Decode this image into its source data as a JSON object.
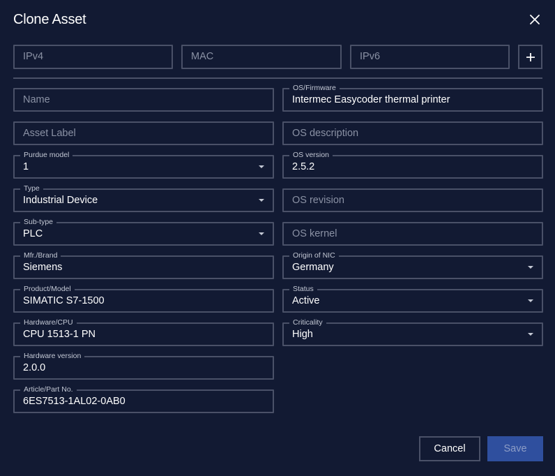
{
  "dialog": {
    "title": "Clone Asset"
  },
  "network": {
    "ipv4_placeholder": "IPv4",
    "mac_placeholder": "MAC",
    "ipv6_placeholder": "IPv6",
    "add_label": "+"
  },
  "fields": {
    "name": {
      "placeholder": "Name"
    },
    "asset_label": {
      "placeholder": "Asset Label"
    },
    "purdue_model": {
      "label": "Purdue model",
      "value": "1"
    },
    "type": {
      "label": "Type",
      "value": "Industrial Device"
    },
    "sub_type": {
      "label": "Sub-type",
      "value": "PLC"
    },
    "mfr_brand": {
      "label": "Mfr./Brand",
      "value": "Siemens"
    },
    "product_model": {
      "label": "Product/Model",
      "value": "SIMATIC S7-1500"
    },
    "hardware_cpu": {
      "label": "Hardware/CPU",
      "value": "CPU 1513-1 PN"
    },
    "hardware_version": {
      "label": "Hardware version",
      "value": "2.0.0"
    },
    "article_part_no": {
      "label": "Article/Part No.",
      "value": "6ES7513-1AL02-0AB0"
    },
    "os_firmware": {
      "label": "OS/Firmware",
      "value": "Intermec Easycoder thermal printer"
    },
    "os_description": {
      "placeholder": "OS description"
    },
    "os_version": {
      "label": "OS version",
      "value": "2.5.2"
    },
    "os_revision": {
      "placeholder": "OS revision"
    },
    "os_kernel": {
      "placeholder": "OS kernel"
    },
    "origin_of_nic": {
      "label": "Origin of NIC",
      "value": "Germany"
    },
    "status": {
      "label": "Status",
      "value": "Active"
    },
    "criticality": {
      "label": "Criticality",
      "value": "High"
    }
  },
  "actions": {
    "cancel_label": "Cancel",
    "save_label": "Save"
  },
  "icons": {
    "close": "close-icon",
    "add": "plus-icon",
    "dropdown": "chevron-down-icon"
  },
  "colors": {
    "background": "#121a33",
    "border": "#4a5168",
    "primary": "#2f4f9e"
  }
}
